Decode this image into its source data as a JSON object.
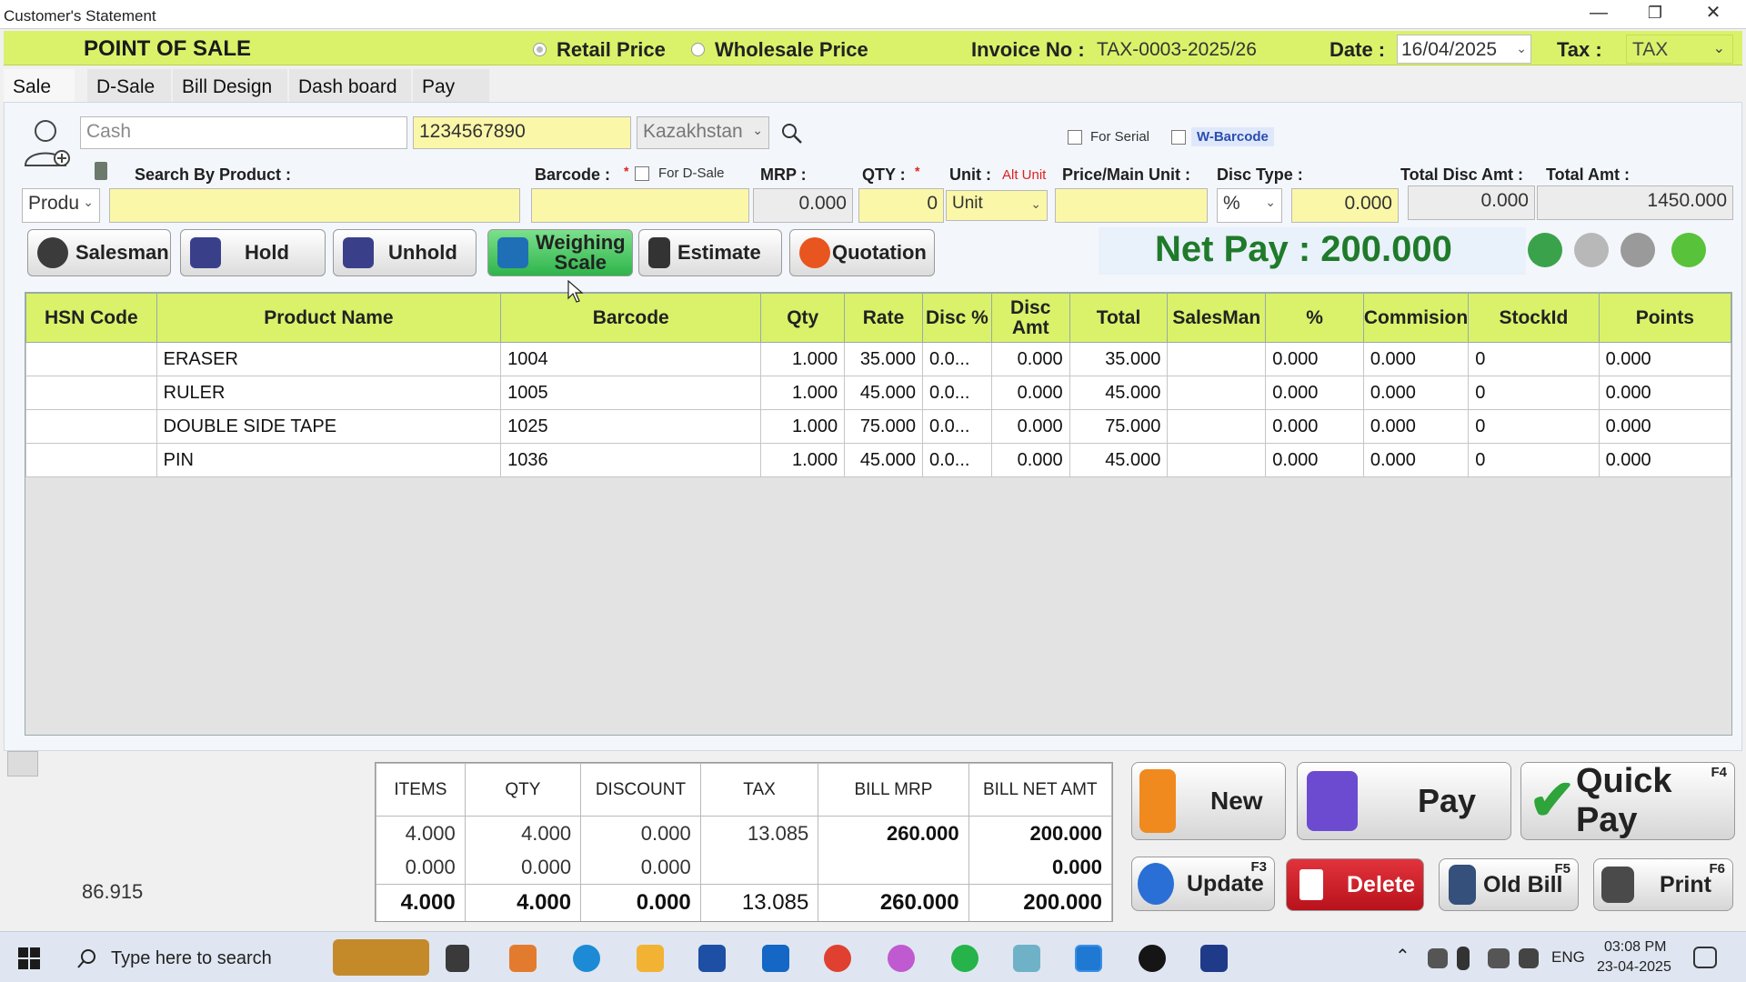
{
  "window": {
    "title": "Customer's Statement"
  },
  "header": {
    "title": "POINT OF SALE",
    "retail_label": "Retail Price",
    "wholesale_label": "Wholesale Price",
    "invoice_label": "Invoice No :",
    "invoice_value": "TAX-0003-2025/26",
    "date_label": "Date :",
    "date_value": "16/04/2025",
    "tax_label": "Tax :",
    "tax_value": "TAX"
  },
  "tabs": [
    "Sale",
    "D-Sale",
    "Bill Design",
    "Dash board",
    "Pay"
  ],
  "customer": {
    "name_placeholder": "Cash",
    "phone": "1234567890",
    "country": "Kazakhstan",
    "for_serial_label": "For Serial",
    "w_barcode_label": "W-Barcode"
  },
  "entry": {
    "search_label": "Search By Product :",
    "search_type": "Produ",
    "barcode_label": "Barcode :",
    "req_mark": "*",
    "for_dsale_label": "For D-Sale",
    "mrp_label": "MRP :",
    "mrp_value": "0.000",
    "qty_label": "QTY :",
    "qty_value": "0",
    "unit_label": "Unit :",
    "alt_unit_label": "Alt Unit",
    "unit_value": "Unit",
    "price_main_label": "Price/Main Unit :",
    "disc_type_label": "Disc Type :",
    "disc_type_value": "%",
    "disc_value": "0.000",
    "total_disc_label": "Total Disc Amt :",
    "total_disc_value": "0.000",
    "total_amt_label": "Total Amt :",
    "total_amt_value": "1450.000"
  },
  "actions": {
    "salesman": "Salesman",
    "hold": "Hold",
    "unhold": "Unhold",
    "weighing_scale_1": "Weighing",
    "weighing_scale_2": "Scale",
    "estimate": "Estimate",
    "quotation": "Quotation"
  },
  "net_pay": "Net Pay : 200.000",
  "grid": {
    "columns": [
      "HSN Code",
      "Product Name",
      "Barcode",
      "Qty",
      "Rate",
      "Disc %",
      "Disc Amt",
      "Total",
      "SalesMan",
      "%",
      "Commision",
      "StockId",
      "Points"
    ],
    "rows": [
      [
        "",
        "ERASER",
        "1004",
        "1.000",
        "35.000",
        "0.0...",
        "0.000",
        "35.000",
        "",
        "0.000",
        "0.000",
        "0",
        "0.000"
      ],
      [
        "",
        "RULER",
        "1005",
        "1.000",
        "45.000",
        "0.0...",
        "0.000",
        "45.000",
        "",
        "0.000",
        "0.000",
        "0",
        "0.000"
      ],
      [
        "",
        "DOUBLE SIDE TAPE",
        "1025",
        "1.000",
        "75.000",
        "0.0...",
        "0.000",
        "75.000",
        "",
        "0.000",
        "0.000",
        "0",
        "0.000"
      ],
      [
        "",
        "PIN",
        "1036",
        "1.000",
        "45.000",
        "0.0...",
        "0.000",
        "45.000",
        "",
        "0.000",
        "0.000",
        "0",
        "0.000"
      ]
    ]
  },
  "footer": {
    "left_value": "86.915",
    "summary_headers": [
      "ITEMS",
      "QTY",
      "DISCOUNT",
      "TAX",
      "BILL MRP",
      "BILL NET AMT"
    ],
    "summary_rows": [
      [
        "4.000",
        "4.000",
        "0.000",
        "13.085",
        "260.000",
        "200.000"
      ],
      [
        "0.000",
        "0.000",
        "0.000",
        "",
        "",
        "0.000"
      ],
      [
        "4.000",
        "4.000",
        "0.000",
        "13.085",
        "260.000",
        "200.000"
      ]
    ],
    "buttons": {
      "new": "New",
      "pay": "Pay",
      "quick_pay": "Quick Pay",
      "quick_pay_key": "F4",
      "update": "Update",
      "update_key": "F3",
      "delete": "Delete",
      "old_bill": "Old Bill",
      "old_bill_key": "F5",
      "print": "Print",
      "print_key": "F6"
    }
  },
  "taskbar": {
    "search_placeholder": "Type here to search",
    "lang": "ENG",
    "time": "03:08 PM",
    "date": "23-04-2025"
  },
  "colors": {
    "header_yellow": "#d9f26a",
    "input_yellow": "#fbf7a9",
    "net_pay_green": "#1f7a2a",
    "delete_red": "#d01f2a"
  }
}
